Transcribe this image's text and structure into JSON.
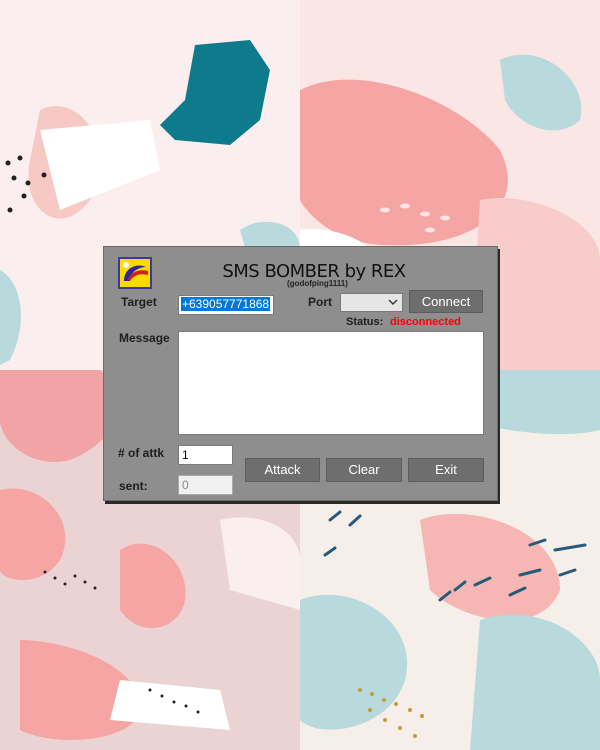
{
  "colors": {
    "window_bg": "#8e8e8e",
    "button_bg": "#6e6e6e",
    "status_red": "#ff0000",
    "selection_blue": "#0078d7"
  },
  "app": {
    "title": "SMS BOMBER",
    "by": " by REX",
    "subtitle": "(godofping1111)",
    "icon": "app-logo-icon"
  },
  "target": {
    "label": "Target",
    "value": "+639057771868"
  },
  "port": {
    "label": "Port",
    "selected": ""
  },
  "connect_label": "Connect",
  "status": {
    "label": "Status:",
    "value": "disconnected"
  },
  "message": {
    "label": "Message",
    "value": ""
  },
  "attack_count": {
    "label": "# of attk",
    "value": "1"
  },
  "sent": {
    "label": "sent:",
    "value": "0"
  },
  "buttons": {
    "attack": "Attack",
    "clear": "Clear",
    "exit": "Exit"
  }
}
